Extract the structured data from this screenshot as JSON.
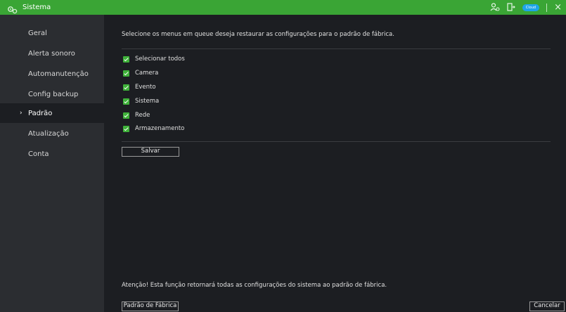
{
  "titlebar": {
    "title": "Sistema",
    "cloud_label": "Cloud",
    "close_label": "×",
    "accent_color": "#3aa535"
  },
  "sidebar": {
    "items": [
      {
        "label": "Geral",
        "active": false
      },
      {
        "label": "Alerta sonoro",
        "active": false
      },
      {
        "label": "Automanutenção",
        "active": false
      },
      {
        "label": "Config backup",
        "active": false
      },
      {
        "label": "Padrão",
        "active": true
      },
      {
        "label": "Atualização",
        "active": false
      },
      {
        "label": "Conta",
        "active": false
      }
    ],
    "active_chevron": "›"
  },
  "main": {
    "description": "Selecione os menus em queue deseja restaurar as configurações para o padrão de fábrica.",
    "checkboxes": [
      {
        "label": "Selecionar todos",
        "checked": true
      },
      {
        "label": "Camera",
        "checked": true
      },
      {
        "label": "Evento",
        "checked": true
      },
      {
        "label": "Sistema",
        "checked": true
      },
      {
        "label": "Rede",
        "checked": true
      },
      {
        "label": "Armazenamento",
        "checked": true
      }
    ],
    "save_label": "Salvar",
    "warning": "Atenção! Esta função retornará todas as configurações do sistema ao padrão de fábrica.",
    "factory_label": "Padrão de Fábrica",
    "cancel_label": "Cancelar"
  }
}
